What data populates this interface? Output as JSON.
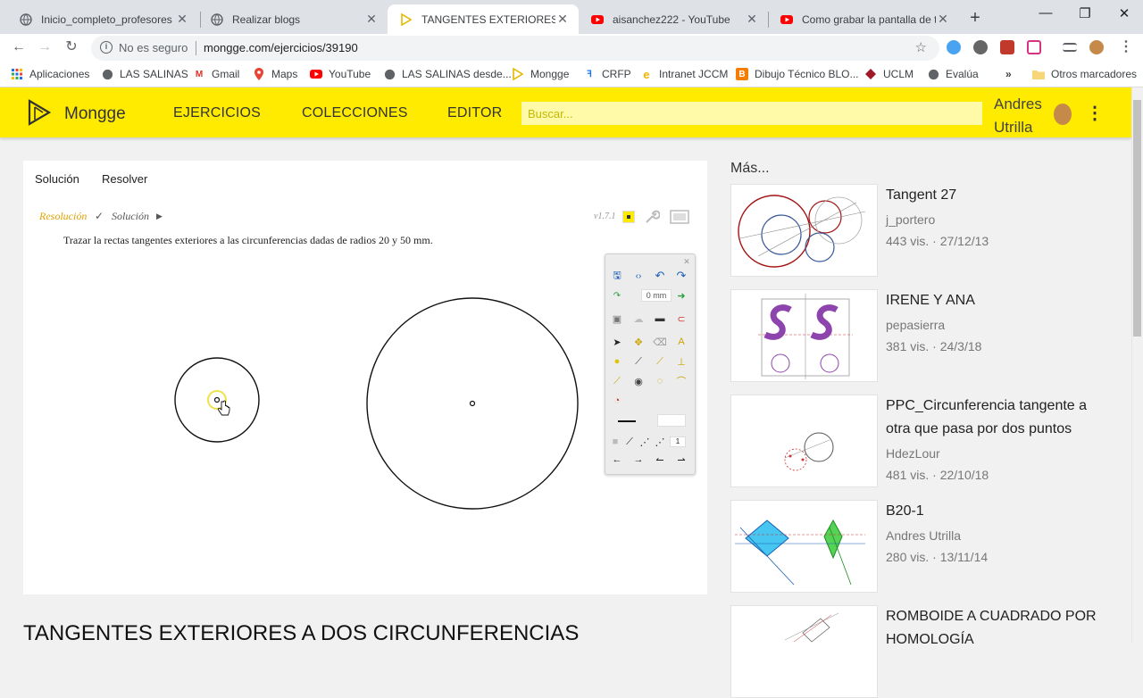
{
  "browser": {
    "tabs": [
      {
        "title": "Inicio_completo_profesores",
        "icon": "globe-icon"
      },
      {
        "title": "Realizar blogs",
        "icon": "globe-icon"
      },
      {
        "title": "TANGENTES EXTERIORES A DOS CIRCUNFERENCIAS",
        "icon": "mongge-icon"
      },
      {
        "title": "aisanchez222 - YouTube",
        "icon": "youtube-icon"
      },
      {
        "title": "Como grabar la pantalla de tu ordenador",
        "icon": "youtube-icon"
      }
    ],
    "security_label": "No es seguro",
    "url": "mongge.com/ejercicios/39190"
  },
  "bookmarks": [
    {
      "label": "Aplicaciones",
      "icon": "apps-icon"
    },
    {
      "label": "LAS SALINAS",
      "icon": "globe-icon"
    },
    {
      "label": "Gmail",
      "icon": "gmail-icon"
    },
    {
      "label": "Maps",
      "icon": "maps-icon"
    },
    {
      "label": "YouTube",
      "icon": "youtube-icon"
    },
    {
      "label": "LAS SALINAS desde...",
      "icon": "globe-icon"
    },
    {
      "label": "Mongge",
      "icon": "mongge-icon"
    },
    {
      "label": "CRFP",
      "icon": "crfp-icon"
    },
    {
      "label": "Intranet JCCM",
      "icon": "intranet-icon"
    },
    {
      "label": "Dibujo Técnico BLO...",
      "icon": "blogger-icon"
    },
    {
      "label": "UCLM",
      "icon": "uclm-icon"
    },
    {
      "label": "Evalúa",
      "icon": "globe-icon"
    },
    {
      "label": "Otros marcadores",
      "icon": "folder-icon"
    }
  ],
  "site": {
    "brand": "Mongge",
    "nav": [
      "EJERCICIOS",
      "COLECCIONES",
      "EDITOR"
    ],
    "search_placeholder": "Buscar...",
    "user": "Andres Utrilla",
    "accent": "#ffeb00"
  },
  "exercise": {
    "tabs": [
      "Solución",
      "Resolver"
    ],
    "breadcrumb_resolucion": "Resolución",
    "breadcrumb_solucion": "Solución",
    "version": "v1.7.1",
    "statement": "Trazar la rectas tangentes exteriores a las circunferencias dadas de radios 20 y 50 mm.",
    "palette_mm": "0 mm",
    "palette_width": "1",
    "title": "TANGENTES EXTERIORES A DOS CIRCUNFERENCIAS"
  },
  "sidebar": {
    "heading": "Más...",
    "items": [
      {
        "title": "Tangent 27",
        "author": "j_portero",
        "stats": "443 vis. · 27/12/13"
      },
      {
        "title": "IRENE Y ANA",
        "author": "pepasierra",
        "stats": "381 vis. · 24/3/18"
      },
      {
        "title": "PPC_Circunferencia tangente a otra que pasa por dos puntos",
        "author": "HdezLour",
        "stats": "481 vis. · 22/10/18"
      },
      {
        "title": "B20-1",
        "author": "Andres Utrilla",
        "stats": "280 vis. · 13/11/14"
      },
      {
        "title": "ROMBOIDE A CUADRADO POR HOMOLOGÍA",
        "author": "",
        "stats": ""
      }
    ]
  }
}
